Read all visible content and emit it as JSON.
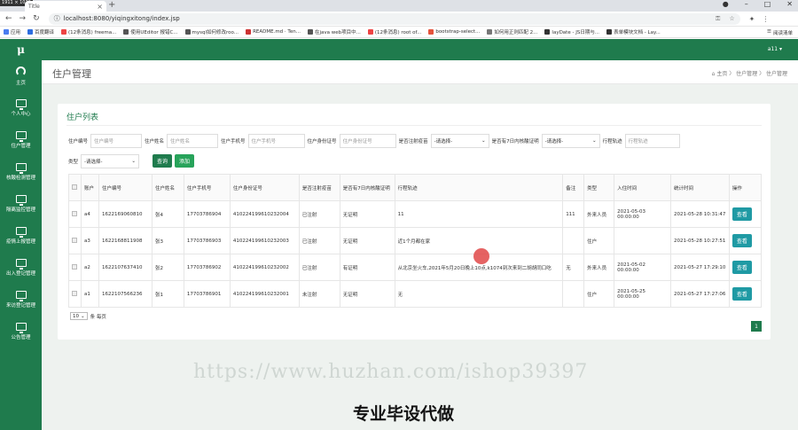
{
  "browser": {
    "corner_label": "1911 × 1030",
    "tab_title": "Title",
    "url": "localhost:8080/yiqingxitong/index.jsp",
    "bookmarks": [
      "应用",
      "百度翻译",
      "(12条消息) freema...",
      "使用UEditor 报错C...",
      "mysql如何修改roo...",
      "README.md · Ten...",
      "在java web项目中...",
      "(12条消息) root of...",
      "bootstrap-select...",
      "如何用正则匹配 2...",
      "layDate - JS日期与...",
      "表单模块文档 - Lay..."
    ],
    "bookmarks_other": "阅读清单"
  },
  "sidebar": {
    "logo": "μ",
    "items": [
      "主页",
      "个人中心",
      "住户管理",
      "核酸检测管理",
      "隔离监控管理",
      "疫情上报管理",
      "出入登记管理",
      "来访登记管理",
      "公告管理"
    ]
  },
  "topbar": {
    "user": "a11 ▾"
  },
  "page": {
    "title": "住户管理",
    "breadcrumb": "⌂ 主页 〉 住户管理 〉 住户管理"
  },
  "panel": {
    "title": "住户列表"
  },
  "filters": {
    "l1": "住户编号",
    "p1": "住户编号",
    "l2": "住户姓名",
    "p2": "住户姓名",
    "l3": "住户手机号",
    "p3": "住户手机号",
    "l4": "住户身份证号",
    "p4": "住户身份证号",
    "l5": "是否注射疫苗",
    "s5": "-请选择-",
    "l6": "是否有7日内核酸证明",
    "s6": "-请选择-",
    "l7": "行程轨迹",
    "p7": "行程轨迹",
    "l8": "类型",
    "s8": "-请选择-",
    "search": "查询",
    "add": "添加"
  },
  "table": {
    "headers": [
      "账户",
      "住户编号",
      "住户姓名",
      "住户手机号",
      "住户身份证号",
      "是否注射疫苗",
      "是否有7日内核酸证明",
      "行程轨迹",
      "备注",
      "类型",
      "入住时间",
      "统计时间",
      "操作"
    ],
    "rows": [
      [
        "a4",
        "1622169060810",
        "张4",
        "17703786904",
        "410224199610232004",
        "已注射",
        "无证明",
        "11",
        "111",
        "外来人员",
        "2021-05-03 00:00:00",
        "2021-05-28 10:31:47",
        "查看"
      ],
      [
        "a3",
        "1622168811908",
        "张3",
        "17703786903",
        "410224199610232003",
        "已注射",
        "无证明",
        "近1个月都在家",
        "",
        "住户",
        "",
        "2021-05-28 10:27:51",
        "查看"
      ],
      [
        "a2",
        "1622107637410",
        "张2",
        "17703786902",
        "410224199610232002",
        "已注射",
        "有证明",
        "从北京坐火车,2021年5月20日晚上10点,k1074到次来到二胡胡同口吃",
        "无",
        "外来人员",
        "2021-05-02 00:00:00",
        "2021-05-27 17:29:10",
        "查看"
      ],
      [
        "a1",
        "1622107566236",
        "张1",
        "17703786901",
        "410224199610232001",
        "未注射",
        "无证明",
        "无",
        "",
        "住户",
        "2021-05-25 00:00:00",
        "2021-05-27 17:27:06",
        "查看"
      ]
    ]
  },
  "pager": {
    "size": "10",
    "size_suffix": "条 每页",
    "current": "1"
  },
  "overlay": {
    "watermark": "https://www.huzhan.com/ishop39397",
    "caption": "专业毕设代做"
  },
  "colors": {
    "primary": "#1f7b4d",
    "view_button": "#1f9aa4"
  }
}
